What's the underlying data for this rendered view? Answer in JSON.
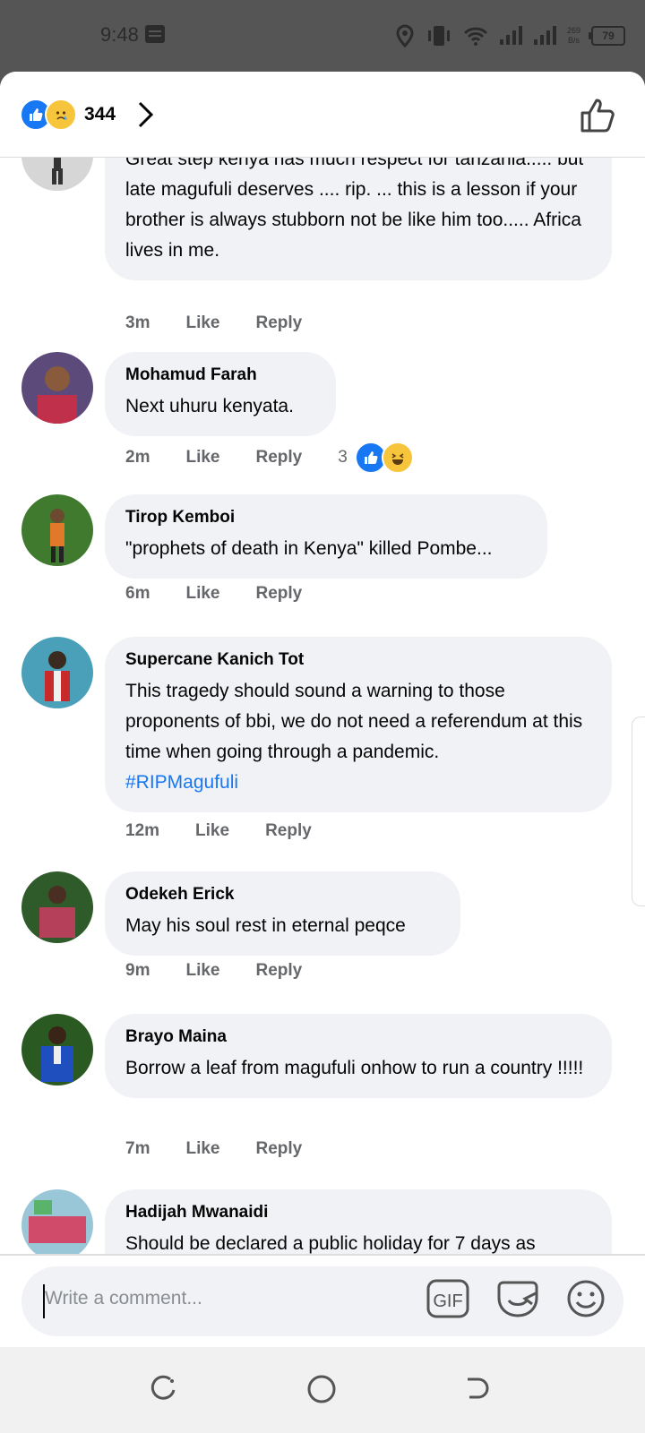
{
  "status_bar": {
    "time": "9:48",
    "net_speed_value": "269",
    "net_speed_unit": "B/s",
    "battery": "79"
  },
  "header": {
    "reaction_count": "344",
    "reaction_icons": [
      "like-icon",
      "sad-icon"
    ]
  },
  "comments": [
    {
      "name": "",
      "text": "Great step kenya has much respect for tanzania..... but late magufuli deserves .... rip. ... this is a lesson if your brother is always stubborn not be like him too..... Africa lives in me.",
      "time": "3m",
      "like": "Like",
      "reply": "Reply"
    },
    {
      "name": "Mohamud Farah",
      "text": "Next uhuru kenyata.",
      "time": "2m",
      "like": "Like",
      "reply": "Reply",
      "reaction_count": "3",
      "reaction_icons": [
        "like-icon",
        "haha-icon"
      ]
    },
    {
      "name": "Tirop Kemboi",
      "text": "\"prophets of death in Kenya\" killed Pombe...",
      "time": "6m",
      "like": "Like",
      "reply": "Reply"
    },
    {
      "name": "Supercane Kanich Tot",
      "text": "This tragedy should sound a warning to those proponents of bbi, we do not need a referendum at this time when going through a pandemic.",
      "hashtag": "#RIPMagufuli",
      "time": "12m",
      "like": "Like",
      "reply": "Reply"
    },
    {
      "name": "Odekeh Erick",
      "text": "May his soul rest in eternal peqce",
      "time": "9m",
      "like": "Like",
      "reply": "Reply"
    },
    {
      "name": "Brayo Maina",
      "text": "Borrow a leaf from magufuli onhow to run a country !!!!!",
      "time": "7m",
      "like": "Like",
      "reply": "Reply"
    },
    {
      "name": "Hadijah Mwanaidi",
      "text": "Should be declared a public holiday for 7 days as",
      "time": "",
      "like": "",
      "reply": ""
    }
  ],
  "composer": {
    "placeholder": "Write a comment...",
    "gif_label": "GIF"
  },
  "colors": {
    "link": "#1877f2",
    "bubble": "#f0f2f5",
    "meta": "#65676b"
  }
}
